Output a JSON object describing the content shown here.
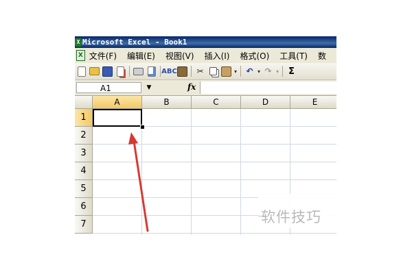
{
  "window": {
    "title": "Microsoft Excel - Book1"
  },
  "menu": {
    "items": [
      "文件(F)",
      "编辑(E)",
      "视图(V)",
      "插入(I)",
      "格式(O)",
      "工具(T)",
      "数"
    ]
  },
  "toolbar": {
    "buttons": [
      "new-icon",
      "open-icon",
      "save-icon",
      "permission-icon",
      "print-icon",
      "print-preview-icon",
      "spelling-icon",
      "research-icon",
      "cut-icon",
      "copy-icon",
      "paste-icon",
      "undo-icon",
      "redo-icon",
      "autosum-icon"
    ],
    "sum_glyph": "Σ"
  },
  "formula_bar": {
    "name_box": "A1",
    "fx_label": "fx",
    "formula_value": ""
  },
  "sheet": {
    "columns": [
      "A",
      "B",
      "C",
      "D",
      "E"
    ],
    "rows": [
      "1",
      "2",
      "3",
      "4",
      "5",
      "6",
      "7"
    ],
    "active_cell": "A1"
  },
  "watermark": {
    "text": "软件技巧"
  },
  "colors": {
    "titlebar": "#0a246a",
    "selection_header": "#f3c867",
    "annotation_arrow": "#d63a32"
  }
}
